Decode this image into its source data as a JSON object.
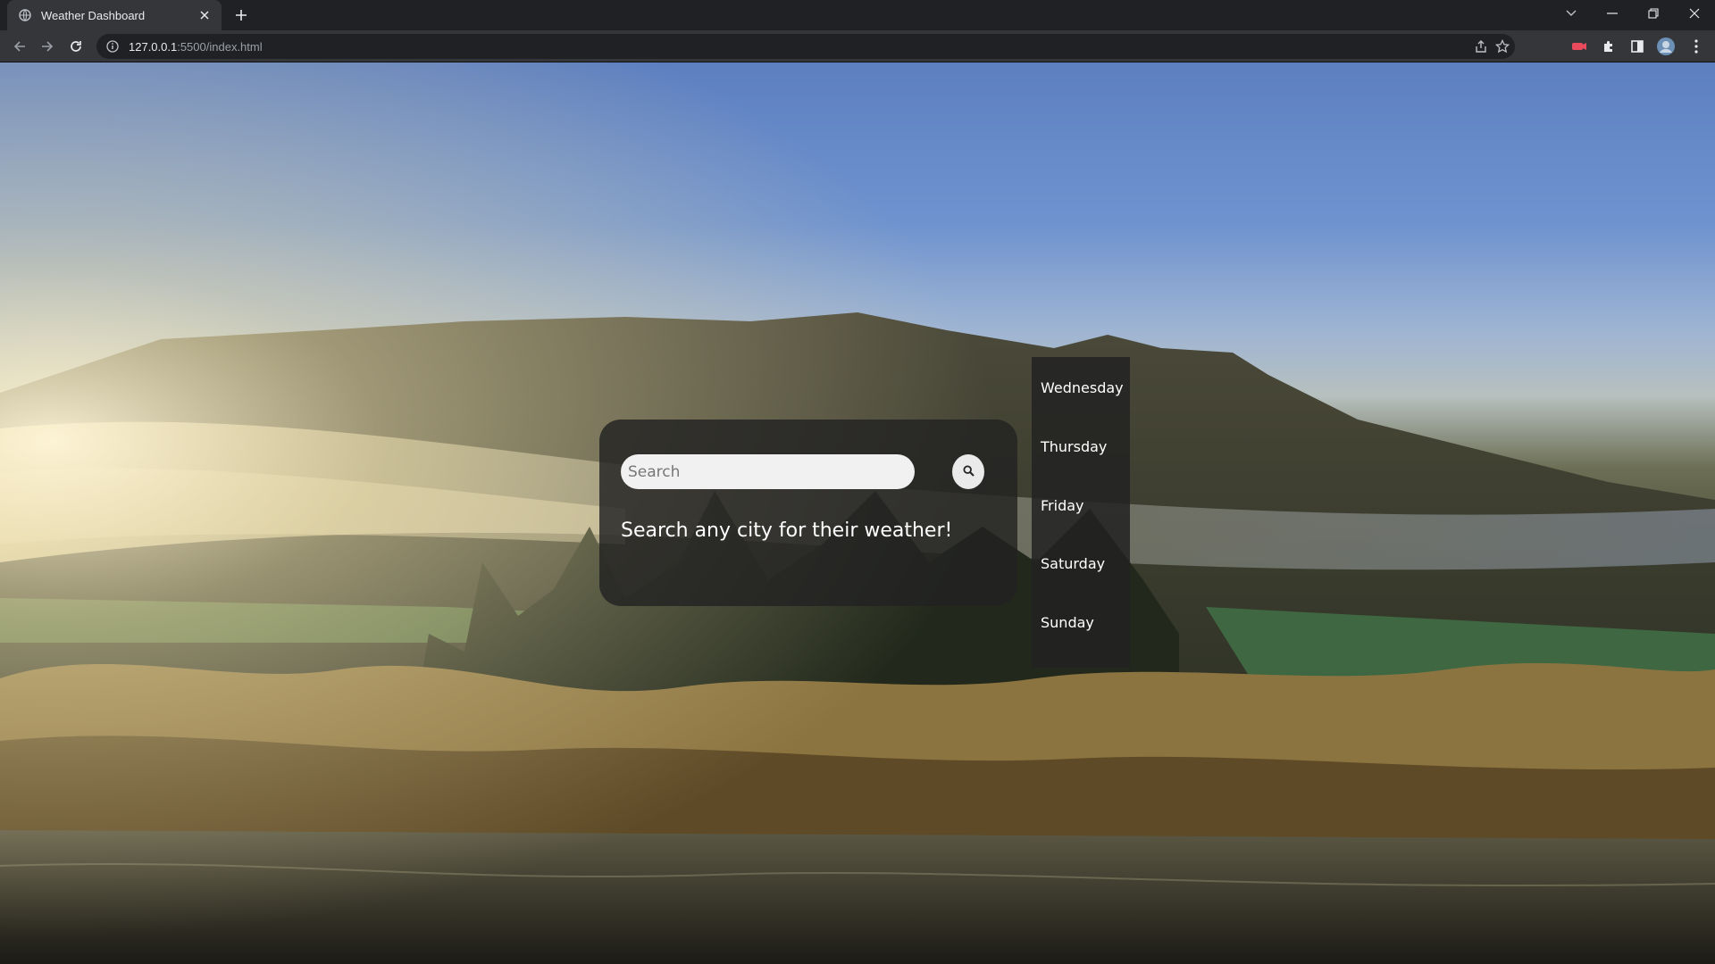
{
  "browser": {
    "tab_title": "Weather Dashboard",
    "url_host": "127.0.0.1",
    "url_rest": ":5500/index.html"
  },
  "weather": {
    "search_placeholder": "Search",
    "message": "Search any city for their weather!",
    "days": [
      "Wednesday",
      "Thursday",
      "Friday",
      "Saturday",
      "Sunday"
    ]
  },
  "icons": {
    "tab_favicon": "globe-icon",
    "search_button": "search-icon"
  }
}
